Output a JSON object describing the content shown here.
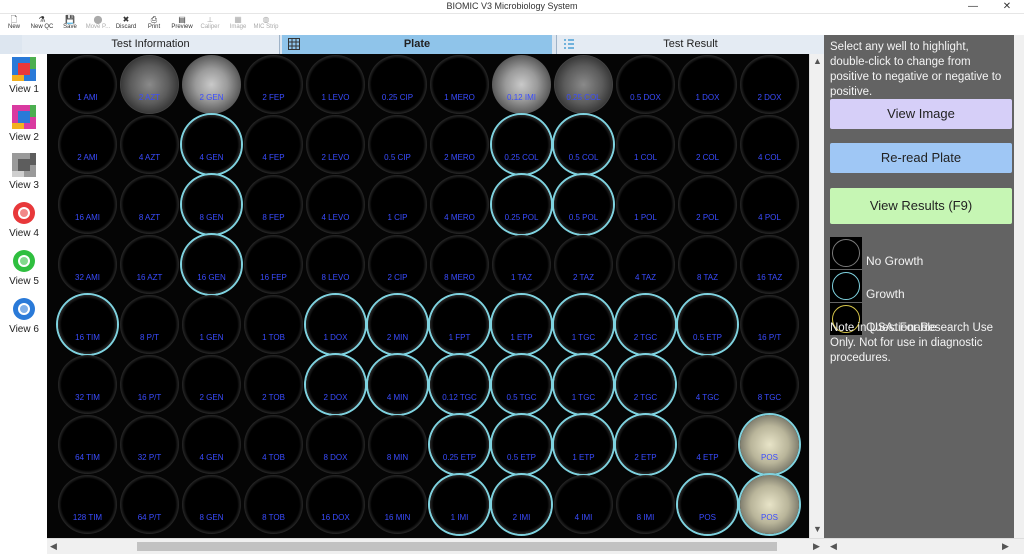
{
  "window": {
    "title": "BIOMIC V3 Microbiology System",
    "minimize": "—",
    "close": "✕"
  },
  "toolbar": [
    {
      "label": "New",
      "icon": "new-file-icon",
      "glyph": "🗋",
      "enabled": true
    },
    {
      "label": "New QC",
      "icon": "new-qc-icon",
      "glyph": "⚗",
      "enabled": true
    },
    {
      "label": "Save",
      "icon": "save-icon",
      "glyph": "💾",
      "enabled": true
    },
    {
      "label": "Move P...",
      "icon": "move-plate-icon",
      "glyph": "⬤",
      "enabled": false
    },
    {
      "label": "Discard",
      "icon": "discard-icon",
      "glyph": "✖",
      "enabled": true
    },
    {
      "label": "Print",
      "icon": "print-icon",
      "glyph": "⎙",
      "enabled": true
    },
    {
      "label": "Preview",
      "icon": "preview-icon",
      "glyph": "▤",
      "enabled": true
    },
    {
      "label": "Caliper",
      "icon": "caliper-icon",
      "glyph": "⟂",
      "enabled": false
    },
    {
      "label": "Image",
      "icon": "image-icon",
      "glyph": "▦",
      "enabled": false
    },
    {
      "label": "MIC Strip",
      "icon": "mic-strip-icon",
      "glyph": "◍",
      "enabled": false
    }
  ],
  "tabs": [
    {
      "label": "Test Information",
      "icon": ""
    },
    {
      "label": "Plate",
      "icon": "grid-icon"
    },
    {
      "label": "Test Result",
      "icon": "list-icon"
    }
  ],
  "views": [
    {
      "label": "View 1",
      "icon": "view-1-icon",
      "colors": [
        "#2a7ad8",
        "#e8383a",
        "#f2b120",
        "#4caf50"
      ]
    },
    {
      "label": "View 2",
      "icon": "view-2-icon",
      "colors": [
        "#d93aa0",
        "#2a7ad8",
        "#f2b120",
        "#4caf50"
      ]
    },
    {
      "label": "View 3",
      "icon": "view-3-icon",
      "colors": [
        "#9a9a9a",
        "#5d5d5d",
        "#cfcfcf",
        "#5d5d5d"
      ]
    },
    {
      "label": "View 4",
      "icon": "view-4-icon",
      "colors": [
        "#e8383a"
      ]
    },
    {
      "label": "View 5",
      "icon": "view-5-icon",
      "colors": [
        "#2fbf3f"
      ]
    },
    {
      "label": "View 6",
      "icon": "view-6-icon",
      "colors": [
        "#2a7ad8"
      ]
    }
  ],
  "plate": {
    "rows": [
      [
        {
          "label": "1 AMI",
          "state": "none"
        },
        {
          "label": "2 AZT",
          "state": "grey"
        },
        {
          "label": "2 GEN",
          "state": "light"
        },
        {
          "label": "2 FEP",
          "state": "none"
        },
        {
          "label": "1 LEVO",
          "state": "none"
        },
        {
          "label": "0.25 CIP",
          "state": "none"
        },
        {
          "label": "1 MERO",
          "state": "none"
        },
        {
          "label": "0.12 IMI",
          "state": "light"
        },
        {
          "label": "0.25 COL",
          "state": "grey"
        },
        {
          "label": "0.5 DOX",
          "state": "none"
        },
        {
          "label": "1 DOX",
          "state": "none"
        },
        {
          "label": "2 DOX",
          "state": "none"
        }
      ],
      [
        {
          "label": "2 AMI",
          "state": "none"
        },
        {
          "label": "4 AZT",
          "state": "none"
        },
        {
          "label": "4 GEN",
          "state": "growth"
        },
        {
          "label": "4 FEP",
          "state": "none"
        },
        {
          "label": "2 LEVO",
          "state": "none"
        },
        {
          "label": "0.5 CIP",
          "state": "none"
        },
        {
          "label": "2 MERO",
          "state": "none"
        },
        {
          "label": "0.25 COL",
          "state": "growth"
        },
        {
          "label": "0.5 COL",
          "state": "growth"
        },
        {
          "label": "1 COL",
          "state": "none"
        },
        {
          "label": "2 COL",
          "state": "none"
        },
        {
          "label": "4 COL",
          "state": "none"
        }
      ],
      [
        {
          "label": "16 AMI",
          "state": "none"
        },
        {
          "label": "8 AZT",
          "state": "none"
        },
        {
          "label": "8 GEN",
          "state": "growth"
        },
        {
          "label": "8 FEP",
          "state": "none"
        },
        {
          "label": "4 LEVO",
          "state": "none"
        },
        {
          "label": "1 CIP",
          "state": "none"
        },
        {
          "label": "4 MERO",
          "state": "none"
        },
        {
          "label": "0.25 POL",
          "state": "growth"
        },
        {
          "label": "0.5 POL",
          "state": "growth"
        },
        {
          "label": "1 POL",
          "state": "none"
        },
        {
          "label": "2 POL",
          "state": "none"
        },
        {
          "label": "4 POL",
          "state": "none"
        }
      ],
      [
        {
          "label": "32 AMI",
          "state": "none"
        },
        {
          "label": "16 AZT",
          "state": "none"
        },
        {
          "label": "16 GEN",
          "state": "growth"
        },
        {
          "label": "16 FEP",
          "state": "none"
        },
        {
          "label": "8 LEVO",
          "state": "none"
        },
        {
          "label": "2 CIP",
          "state": "none"
        },
        {
          "label": "8 MERO",
          "state": "none"
        },
        {
          "label": "1 TAZ",
          "state": "none"
        },
        {
          "label": "2 TAZ",
          "state": "none"
        },
        {
          "label": "4 TAZ",
          "state": "none"
        },
        {
          "label": "8 TAZ",
          "state": "none"
        },
        {
          "label": "16 TAZ",
          "state": "none"
        }
      ],
      [
        {
          "label": "16 TIM",
          "state": "growth"
        },
        {
          "label": "8 P/T",
          "state": "none"
        },
        {
          "label": "1 GEN",
          "state": "none"
        },
        {
          "label": "1 TOB",
          "state": "none"
        },
        {
          "label": "1 DOX",
          "state": "growth"
        },
        {
          "label": "2 MIN",
          "state": "growth"
        },
        {
          "label": "1 FPT",
          "state": "growth"
        },
        {
          "label": "1 ETP",
          "state": "growth"
        },
        {
          "label": "1 TGC",
          "state": "growth"
        },
        {
          "label": "2 TGC",
          "state": "growth"
        },
        {
          "label": "0.5 ETP",
          "state": "growth"
        },
        {
          "label": "16 P/T",
          "state": "none"
        }
      ],
      [
        {
          "label": "32 TIM",
          "state": "none"
        },
        {
          "label": "16 P/T",
          "state": "none"
        },
        {
          "label": "2 GEN",
          "state": "none"
        },
        {
          "label": "2 TOB",
          "state": "none"
        },
        {
          "label": "2 DOX",
          "state": "growth"
        },
        {
          "label": "4 MIN",
          "state": "growth"
        },
        {
          "label": "0.12 TGC",
          "state": "growth"
        },
        {
          "label": "0.5 TGC",
          "state": "growth"
        },
        {
          "label": "1 TGC",
          "state": "growth"
        },
        {
          "label": "2 TGC",
          "state": "growth"
        },
        {
          "label": "4 TGC",
          "state": "none"
        },
        {
          "label": "8 TGC",
          "state": "none"
        }
      ],
      [
        {
          "label": "64 TIM",
          "state": "none"
        },
        {
          "label": "32 P/T",
          "state": "none"
        },
        {
          "label": "4 GEN",
          "state": "none"
        },
        {
          "label": "4 TOB",
          "state": "none"
        },
        {
          "label": "8 DOX",
          "state": "none"
        },
        {
          "label": "8 MIN",
          "state": "none"
        },
        {
          "label": "0.25 ETP",
          "state": "growth"
        },
        {
          "label": "0.5 ETP",
          "state": "growth"
        },
        {
          "label": "1 ETP",
          "state": "growth"
        },
        {
          "label": "2 ETP",
          "state": "growth"
        },
        {
          "label": "4 ETP",
          "state": "none"
        },
        {
          "label": "POS",
          "state": "pale"
        }
      ],
      [
        {
          "label": "128 TIM",
          "state": "none"
        },
        {
          "label": "64 P/T",
          "state": "none"
        },
        {
          "label": "8 GEN",
          "state": "none"
        },
        {
          "label": "8 TOB",
          "state": "none"
        },
        {
          "label": "16 DOX",
          "state": "none"
        },
        {
          "label": "16 MIN",
          "state": "none"
        },
        {
          "label": "1 IMI",
          "state": "growth"
        },
        {
          "label": "2 IMI",
          "state": "growth"
        },
        {
          "label": "4 IMI",
          "state": "none"
        },
        {
          "label": "8 IMI",
          "state": "none"
        },
        {
          "label": "POS",
          "state": "growth"
        },
        {
          "label": "POS",
          "state": "pale"
        }
      ]
    ]
  },
  "panel": {
    "instructions": "Select any well to highlight, double-click to change from positive to negative or negative to positive.",
    "view_image": "View Image",
    "reread": "Re-read Plate",
    "view_results": "View Results (F9)",
    "legend": [
      {
        "label": "No Growth",
        "ring_color": "#7a7a7a",
        "icon": "no-growth-legend-icon"
      },
      {
        "label": "Growth",
        "ring_color": "#7fd3e0",
        "icon": "growth-legend-icon"
      },
      {
        "label": "Questionable",
        "ring_color": "#d7c64a",
        "icon": "questionable-legend-icon"
      }
    ],
    "note": "Note in USA: For Research Use Only. Not for use in diagnostic procedures."
  }
}
